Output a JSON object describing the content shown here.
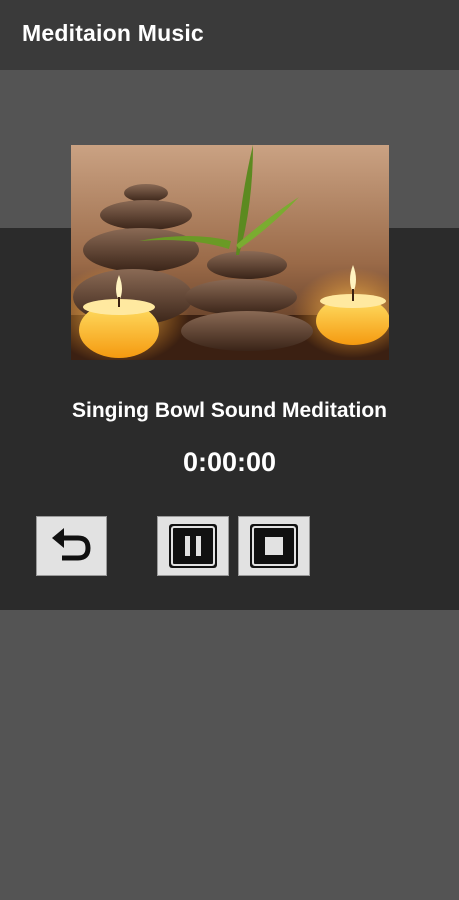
{
  "app_bar": {
    "title": "Meditaion Music"
  },
  "player": {
    "artwork_icon": "zen-stones-candles-image",
    "track_title": "Singing Bowl Sound Meditation",
    "elapsed_time": "0:00:00",
    "controls": [
      {
        "name": "replay-button",
        "icon": "replay-arrow-icon"
      },
      {
        "name": "pause-button",
        "icon": "pause-icon"
      },
      {
        "name": "stop-button",
        "icon": "stop-icon"
      }
    ]
  },
  "colors": {
    "app_bar_bg": "#3a3a3a",
    "page_bg": "#545454",
    "panel_bg": "#2b2b2b",
    "button_bg": "#e2e2e2",
    "text": "#ffffff"
  }
}
